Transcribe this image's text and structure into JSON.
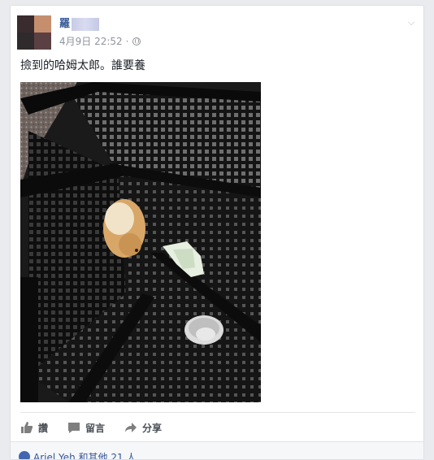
{
  "post": {
    "author": "羅",
    "date": "4月9日 22:52",
    "separator": "·",
    "text": "撿到的哈姆太郎。誰要養"
  },
  "actions": {
    "like_label": "讚",
    "comment_label": "留言",
    "share_label": "分享"
  },
  "likes": {
    "summary": "Ariel Yeh 和其他 21 人"
  },
  "colors": {
    "link": "#365899",
    "meta": "#90949c",
    "action": "#4b4f56",
    "page_bg": "#e9ebee"
  },
  "icons": {
    "privacy": "globe-icon",
    "menu": "chevron-down-icon",
    "like": "thumbs-up-icon",
    "comment": "speech-bubble-icon",
    "share": "share-arrow-icon"
  }
}
